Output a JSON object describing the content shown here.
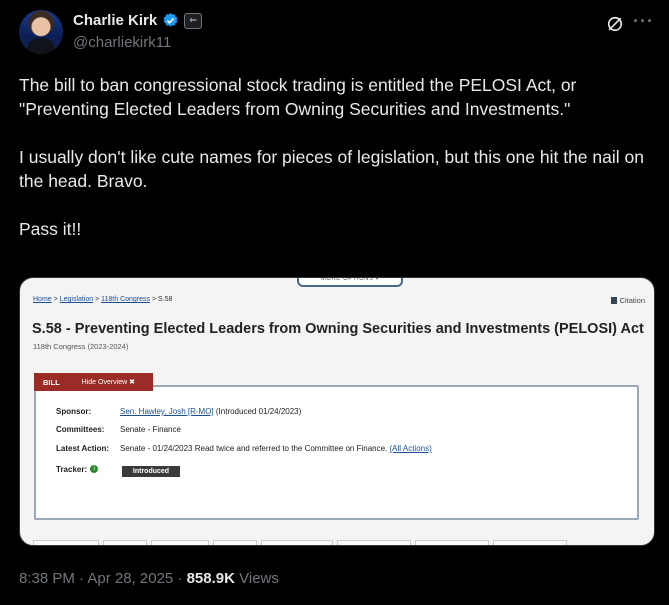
{
  "author": {
    "name": "Charlie Kirk",
    "handle": "@charliekirk11",
    "affiliation_badge": "⇐"
  },
  "tweet": {
    "paragraph1": "The bill to ban congressional stock trading is entitled the PELOSI Act, or \"Preventing Elected Leaders from Owning Securities and Investments.\"",
    "paragraph2": "I usually don't like cute names for pieces of legislation, but this one hit the nail on the head. Bravo.",
    "paragraph3": "Pass it!!"
  },
  "media": {
    "more_options": "MORE OPTIONS ▾",
    "breadcrumb": {
      "home": "Home",
      "sep": " > ",
      "legislation": "Legislation",
      "congress": "118th Congress",
      "bill": "S.58"
    },
    "citation": "Citation",
    "bill_title": "S.58 - Preventing Elected Leaders from Owning Securities and Investments (PELOSI) Act",
    "congress_label": "118th Congress (2023-2024)",
    "tab_bill": "BILL",
    "tab_hide": "Hide Overview ✖",
    "sponsor_label": "Sponsor:",
    "sponsor_link": "Sen. Hawley, Josh [R-MO]",
    "sponsor_note": " (Introduced 01/24/2023)",
    "committees_label": "Committees:",
    "committees_value": "Senate - Finance",
    "latest_label": "Latest Action:",
    "latest_value": "Senate - 01/24/2023 Read twice and referred to the Committee on Finance.",
    "all_actions": "(All Actions)",
    "tracker_label": "Tracker:",
    "tracker_icon": "i",
    "status": "Introduced"
  },
  "meta": {
    "time": "8:38 PM · Apr 28, 2025 · ",
    "views_count": "858.9K",
    "views_label": " Views"
  },
  "colors": {
    "background": "#000000",
    "text": "#e7e9ea",
    "muted": "#71767b",
    "verified": "#1d9bf0",
    "bill_tab": "#9b2b26"
  },
  "icons": [
    "verified-badge-icon",
    "affiliation-badge-icon",
    "grok-icon",
    "more-icon",
    "citation-icon",
    "tracker-info-icon"
  ]
}
